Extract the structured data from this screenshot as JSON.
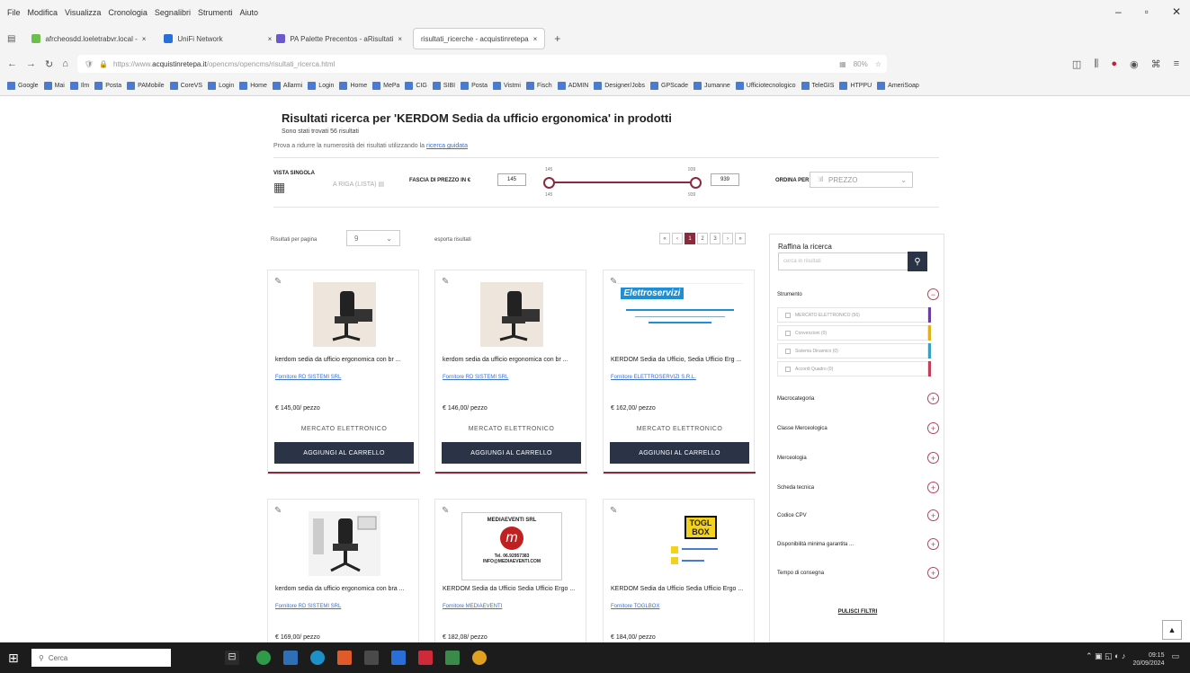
{
  "browser": {
    "menu": [
      "File",
      "Modifica",
      "Visualizza",
      "Cronologia",
      "Segnalibri",
      "Strumenti",
      "Aiuto"
    ],
    "tabs": [
      {
        "label": "afrcheosdd.loeletrabvr.local - ",
        "active": false,
        "color": "#6cbf4a"
      },
      {
        "label": "UniFi Network",
        "active": false,
        "color": "#2a6fd8"
      },
      {
        "label": "PA Palette Precentos - aRisultati",
        "active": false,
        "color": "#6a5acd"
      },
      {
        "label": "risultati_ricerche - acquistinretepa",
        "active": true,
        "color": "#ffffff"
      }
    ],
    "url_host": "acquistinretepa.it",
    "url_path": "/opencms/opencms/risultati_ricerca.html",
    "zoom": "80%",
    "bookmarks": [
      "Google",
      "Mai",
      "Ilm",
      "Posta",
      "PAMobile",
      "CoreVS",
      "Login",
      "Home",
      "Allarmi",
      "Login",
      "Home",
      "MePa",
      "CIG",
      "SIBI",
      "Posta",
      "Vistmi",
      "Fisch",
      "ADMIN",
      "Designer/Jobs",
      "GPScade",
      "Jumanne",
      "Ufficiotecnologico",
      "TeleGIS",
      "HTPPU",
      "AmeriSoap"
    ]
  },
  "page": {
    "title": "Risultati ricerca per 'KERDOM Sedia da ufficio ergonomica' in prodotti",
    "subtitle": "Sono stati trovati 56 risultati",
    "hint_text": "Prova a ridurre la numerosità dei risultati utilizzando la",
    "hint_link": "ricerca guidata",
    "view_label": "VISTA SINGOLA",
    "view_list": "A RIGA (LISTA)",
    "price_label": "FASCIA DI PREZZO IN €",
    "price_min": "145",
    "price_max": "939",
    "slider_low": "145",
    "slider_high": "939",
    "sort_label": "ORDINA PER",
    "sort_value": "PREZZO",
    "perpage_label": "Risultati per pagina",
    "perpage_value": "9",
    "export_label": "esporta risultati",
    "pages": [
      "«",
      "‹",
      "1",
      "2",
      "3",
      "›",
      "»"
    ],
    "current_page": "1"
  },
  "products": [
    {
      "name": "kerdom sedia da ufficio ergonomica con br ...",
      "supplier": "Fornitore RD SISTEMI SRL",
      "price": "€ 145,00/ pezzo",
      "market": "MERCATO ELETTRONICO",
      "cart": "AGGIUNGI AL CARRELLO",
      "img": "chair"
    },
    {
      "name": "kerdom sedia da ufficio ergonomica con br ...",
      "supplier": "Fornitore RD SISTEMI SRL",
      "price": "€ 146,00/ pezzo",
      "market": "MERCATO ELETTRONICO",
      "cart": "AGGIUNGI AL CARRELLO",
      "img": "chair"
    },
    {
      "name": "KERDOM Sedia da Ufficio, Sedia Ufficio Erg ...",
      "supplier": "Fornitore ELETTROSERVIZI S.R.L.",
      "price": "€ 162,00/ pezzo",
      "market": "MERCATO ELETTRONICO",
      "cart": "AGGIUNGI AL CARRELLO",
      "img": "elettro",
      "logo": "Elettroservizi"
    },
    {
      "name": "kerdom sedia da ufficio ergonomica con bra ...",
      "supplier": "Fornitore RD SISTEMI SRL",
      "price": "€ 169,00/ pezzo",
      "img": "chair2"
    },
    {
      "name": "KERDOM Sedia da Ufficio Sedia Ufficio Ergo ...",
      "supplier": "Fornitore MEDIAEVENTI",
      "price": "€ 182,08/ pezzo",
      "img": "media",
      "logo_title": "MEDIAEVENTI SRL",
      "logo_tel": "Tel. 06.92957383",
      "logo_mail": "INFO@MEDIAEVENTI.COM"
    },
    {
      "name": "KERDOM Sedia da Ufficio Sedia Ufficio Ergo ...",
      "supplier": "Fornitore TOGLBOX",
      "price": "€ 184,00/ pezzo",
      "img": "toglbox",
      "logo": "TOGL BOX"
    }
  ],
  "filters": {
    "title": "Raffina la ricerca",
    "search_placeholder": "cerca in risultati",
    "sections": [
      "Strumento",
      "Macrocategoria",
      "Classe Merceologica",
      "Merceologia",
      "Scheda tecnica",
      "Codice CPV",
      "Disponibilità minima garantita ...",
      "Tempo di consegna"
    ],
    "strumento_options": [
      {
        "label": "MERCATO ELETTRONICO (56)",
        "color": "#6a3fa0"
      },
      {
        "label": "Convenzioni (0)",
        "color": "#e0b020"
      },
      {
        "label": "Sistema Dinamico (0)",
        "color": "#3aa0c0"
      },
      {
        "label": "Accordi Quadro (0)",
        "color": "#c0405a"
      }
    ],
    "reset": "PULISCI FILTRI"
  },
  "taskbar": {
    "search": "Cerca",
    "time": "09:15",
    "date": "20/09/2024"
  }
}
